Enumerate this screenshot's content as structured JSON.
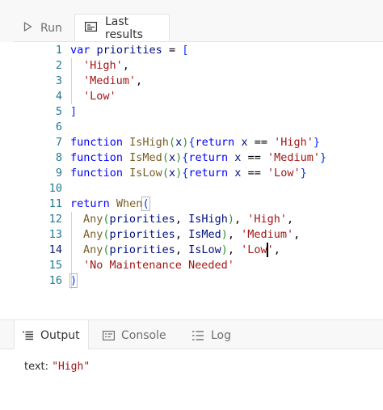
{
  "tabs": {
    "run_label": "Run",
    "last_results_label": "Last results"
  },
  "editor": {
    "line_numbers": [
      "1",
      "2",
      "3",
      "4",
      "5",
      "6",
      "7",
      "8",
      "9",
      "10",
      "11",
      "12",
      "13",
      "14",
      "15",
      "16"
    ],
    "active_line": "14",
    "code": {
      "l1": {
        "kw": "var",
        "id": "priorities",
        "op": " = ",
        "brkt": "["
      },
      "l2": {
        "str": "'High'",
        "punc": ","
      },
      "l3": {
        "str": "'Medium'",
        "punc": ","
      },
      "l4": {
        "str": "'Low'"
      },
      "l5": {
        "brkt": "]"
      },
      "l7": {
        "kw1": "function",
        "fn": "IsHigh",
        "p1": "(",
        "arg": "x",
        "p2": ")",
        "b1": "{",
        "kw2": "return",
        "arg2": "x",
        "op": " == ",
        "str": "'High'",
        "b2": "}"
      },
      "l8": {
        "kw1": "function",
        "fn": "IsMed",
        "p1": "(",
        "arg": "x",
        "p2": ")",
        "b1": "{",
        "kw2": "return",
        "arg2": "x",
        "op": " == ",
        "str": "'Medium'",
        "b2": "}"
      },
      "l9": {
        "kw1": "function",
        "fn": "IsLow",
        "p1": "(",
        "arg": "x",
        "p2": ")",
        "b1": "{",
        "kw2": "return",
        "arg2": "x",
        "op": " == ",
        "str": "'Low'",
        "b2": "}"
      },
      "l11": {
        "kw": "return",
        "fn": "When",
        "p": "("
      },
      "l12": {
        "fn": "Any",
        "p1": "(",
        "id": "priorities",
        "c1": ", ",
        "arg": "IsHigh",
        "p2": ")",
        "c2": ", ",
        "str": "'High'",
        "c3": ","
      },
      "l13": {
        "fn": "Any",
        "p1": "(",
        "id": "priorities",
        "c1": ", ",
        "arg": "IsMed",
        "p2": ")",
        "c2": ", ",
        "str": "'Medium'",
        "c3": ","
      },
      "l14": {
        "fn": "Any",
        "p1": "(",
        "id": "priorities",
        "c1": ", ",
        "arg": "IsLow",
        "p2": ")",
        "c2": ", ",
        "str_a": "'Low",
        "str_b": "'",
        "c3": ","
      },
      "l15": {
        "str": "'No Maintenance Needed'"
      },
      "l16": {
        "p": ")"
      }
    }
  },
  "panel": {
    "output_label": "Output",
    "console_label": "Console",
    "log_label": "Log"
  },
  "result": {
    "key": "text:",
    "value": "\"High\""
  }
}
